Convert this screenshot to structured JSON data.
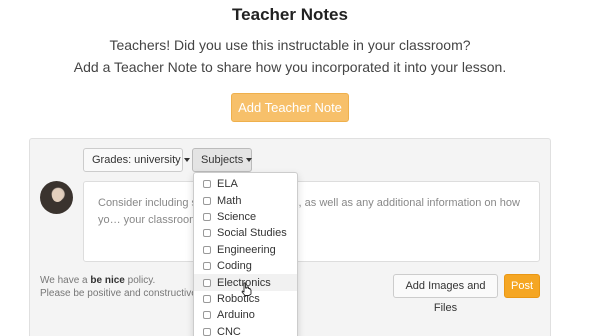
{
  "page": {
    "title": "Teacher Notes",
    "intro_line1": "Teachers! Did you use this instructable in your classroom?",
    "intro_line2": "Add a Teacher Note to share how you incorporated it into your lesson.",
    "add_note_button": "Add Teacher Note"
  },
  "filters": {
    "grades_label": "Grades: university",
    "subjects_label": "Subjects"
  },
  "note": {
    "placeholder": "Consider including st…ssential questions, as well as any additional information on how yo… your classroom..."
  },
  "policy": {
    "line1_prefix": "We have a",
    "line1_bold": "be nice",
    "line1_suffix": "policy.",
    "line2": "Please be positive and constructive."
  },
  "buttons": {
    "images_label": "Add Images and Files",
    "post_label": "Post"
  },
  "subjects_dropdown": {
    "items": [
      "ELA",
      "Math",
      "Science",
      "Social Studies",
      "Engineering",
      "Coding",
      "Electronics",
      "Robotics",
      "Arduino",
      "CNC"
    ],
    "hovered": "Electronics"
  },
  "colors": {
    "add_note_button": "#f7c06a",
    "post_button": "#f5a623",
    "panel_background": "#f4f4f4"
  }
}
